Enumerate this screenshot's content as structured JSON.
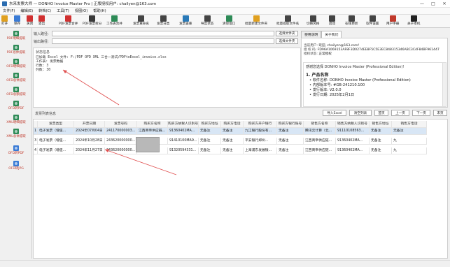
{
  "window": {
    "title": "东来发票大师 — DONHO Invoice Master Pro  |  正版授权用户: chailyen@163.com",
    "controls": [
      "—",
      "□",
      "✕"
    ]
  },
  "menu": [
    "文件(F)",
    "编辑(E)",
    "转档(C)",
    "工具(T)",
    "视图(O)",
    "帮助(H)"
  ],
  "toolbar": [
    {
      "label": "打开",
      "icon": "folder-icon",
      "color": "#e0a020"
    },
    {
      "label": "保存",
      "icon": "save-icon",
      "color": "#3a7bd5"
    },
    {
      "label": "关闭",
      "icon": "close-icon",
      "color": "#d03030"
    },
    {
      "label": "退出",
      "icon": "exit-icon",
      "color": "#d03030"
    },
    {
      "label": "PDF发票合并",
      "icon": "pdf-merge-icon",
      "color": "#d03030"
    },
    {
      "label": "PDF发票拆分",
      "icon": "pdf-split-icon",
      "color": "#3a3a3a"
    },
    {
      "label": "工作表合并",
      "icon": "sheet-merge-icon",
      "color": "#2e8b57"
    },
    {
      "label": "发票重命名",
      "icon": "rename-icon",
      "color": "#444"
    },
    {
      "label": "发票分类",
      "icon": "classify-icon",
      "color": "#444"
    },
    {
      "label": "发票查重",
      "icon": "dedupe-icon",
      "color": "#2a7ab8"
    },
    {
      "label": "导出状态",
      "icon": "export-icon",
      "color": "#444"
    },
    {
      "label": "清空窗口",
      "icon": "clear-icon",
      "color": "#2e8b57"
    },
    {
      "label": "批量新建文件夹",
      "icon": "new-folder-icon",
      "color": "#e0a020"
    },
    {
      "label": "批量提取文件名",
      "icon": "extract-name-icon",
      "color": "#444"
    },
    {
      "label": "切换风格",
      "icon": "theme-icon",
      "color": "#444"
    },
    {
      "label": "启动",
      "icon": "start-icon",
      "color": "#444"
    },
    {
      "label": "在线更新",
      "icon": "update-icon",
      "color": "#444"
    },
    {
      "label": "软件设置",
      "icon": "settings-icon",
      "color": "#444"
    },
    {
      "label": "用户手册",
      "icon": "manual-icon",
      "color": "#c0392b"
    },
    {
      "label": "关于本机",
      "icon": "about-icon",
      "color": "#222"
    }
  ],
  "sidebar": [
    {
      "label": "PDF明细提取",
      "color": "#2e8b57"
    },
    {
      "label": "PDF总体提取",
      "color": "#2e8b57"
    },
    {
      "label": "OFD明细提取",
      "color": "#2e8b57"
    },
    {
      "label": "OFD总体提取",
      "color": "#2e8b57"
    },
    {
      "label": "OFD总额提取",
      "color": "#2e8b57"
    },
    {
      "label": "OFD转PDF",
      "color": "#2e8b57"
    },
    {
      "label": "XML明细提取",
      "color": "#2e8b57"
    },
    {
      "label": "XML总体提取",
      "color": "#2e8b57"
    },
    {
      "label": "OFD转PDF",
      "color": "#3a7bd5"
    },
    {
      "label": "OFD转JPG",
      "color": "#3a7bd5"
    }
  ],
  "inputs": {
    "input_dir_label": "输入路径:",
    "input_dir_value": "",
    "output_dir_label": "输出路径:",
    "output_dir_value": "",
    "select_file_btn": "选择文件夹",
    "select_out_btn": "选择文件夹"
  },
  "status": {
    "header": "状态信息",
    "lines": [
      "已加载 Excel 文件: F:/PDF OFD XML 三合一测试/PDFtoExcel_invoice.xlsx",
      "工作表: 发票数据",
      "行数: 3",
      "列数: 30"
    ]
  },
  "right_tabs": [
    "使用说明",
    "关于我们"
  ],
  "right_info": [
    {
      "k": "当前用户:",
      "v": "欢迎, chailyen@163.com!"
    },
    {
      "k": "授 权 码:",
      "v": "FD96A1069153AF8F3D0274EE8F5C5E3EC848315346ABC3C4F84BF961447"
    },
    {
      "k": "授权状态:",
      "v": "正常授权"
    }
  ],
  "doc": {
    "intro": "感谢您选择 DONHO Invoice Master (Professional Edition)!",
    "h1": "1. 产品名称",
    "bullets": [
      "• 软件名称: DONHO Invoice Master (Professional Edition)",
      "• 内部版本号: #GB-241210.100",
      "• 发行版本: V2.0.0",
      "• 发行日期: 2025年2月1日"
    ]
  },
  "table": {
    "title": "发票列表信息",
    "buttons": [
      "导入Excel",
      "清空列表",
      "首页",
      "上一页",
      "下一页",
      "末页"
    ],
    "columns": [
      "发票类型",
      "开票日期",
      "发票号码",
      "购买方名称",
      "购买方纳税人识别号",
      "购买方地址",
      "购买方电话",
      "购买方开户银行",
      "购买方银行账号",
      "销售方名称",
      "销售方纳税人识别号",
      "销售方地址",
      "销售方电话"
    ],
    "rows": [
      [
        "电子发票（增值...",
        "2024年07月04日",
        "241170000003...",
        "江西商帝供应链...",
        "91360402MA...",
        "无备注",
        "无备注",
        "九江银行股份有...",
        "无备注",
        "腾讯云计算（北...",
        "91110108563...",
        "无备注",
        "无备注"
      ],
      [
        "电子发票（增值...",
        "2024年10月28日",
        "243620000000...",
        "",
        "91410100MA9...",
        "无备注",
        "无备注",
        "平安银行郑州...",
        "无备注",
        "江西商帝供应链...",
        "91360402MA...",
        "无备注",
        "九"
      ],
      [
        "电子发票（增值...",
        "2024年11月27日",
        "243620000000...",
        "",
        "91320594331...",
        "无备注",
        "无备注",
        "上海浦东发展银...",
        "无备注",
        "江西商帝供应链...",
        "91360402MA...",
        "无备注",
        "九"
      ]
    ]
  }
}
